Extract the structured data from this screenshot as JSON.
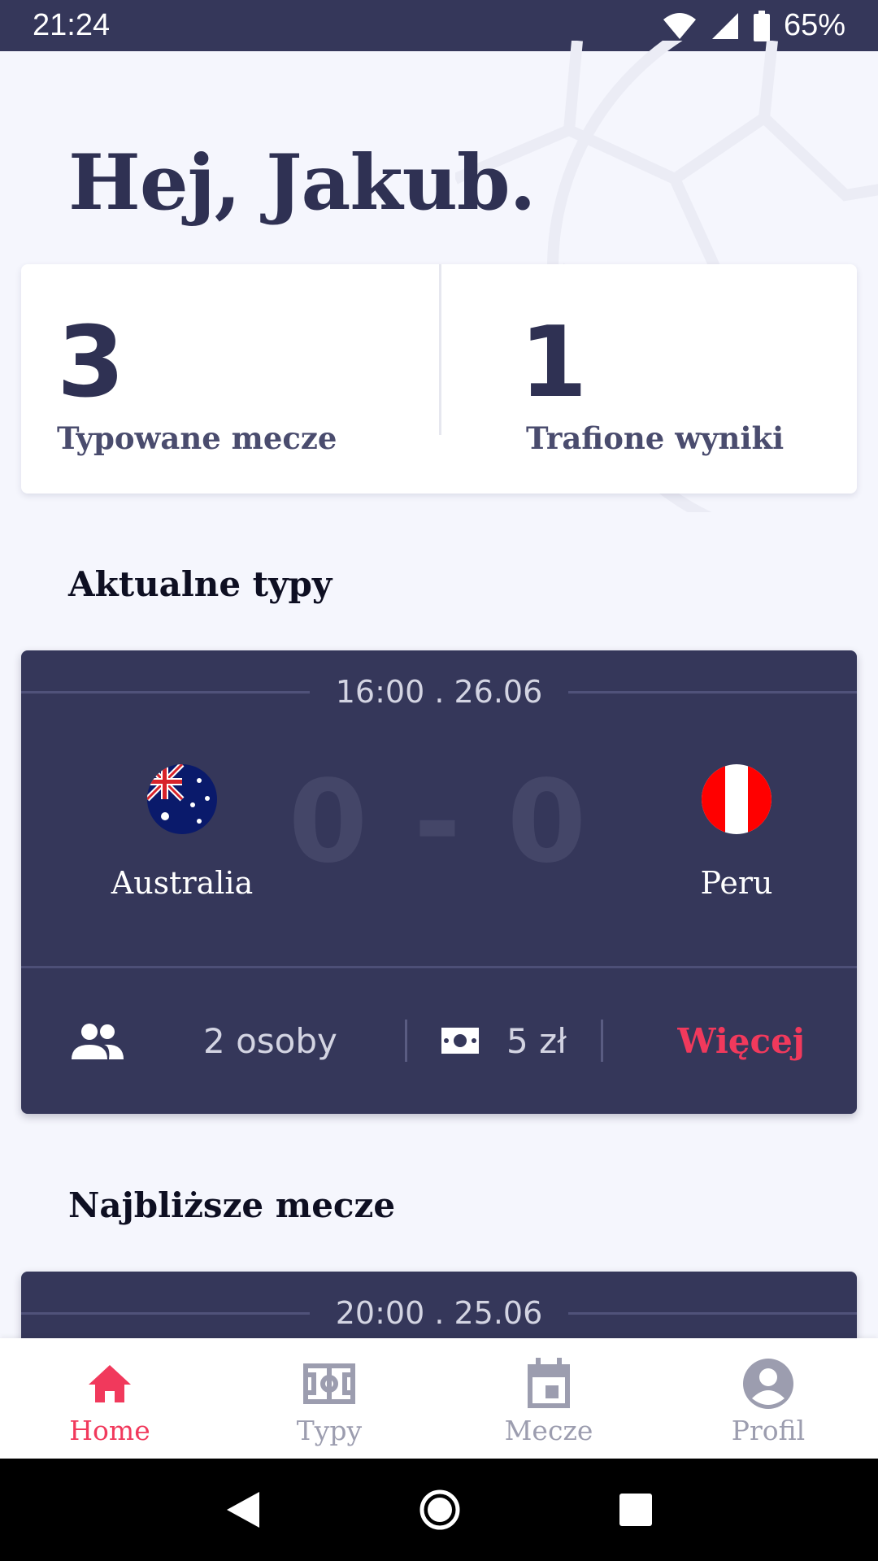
{
  "status_bar": {
    "time": "21:24",
    "battery": "65%"
  },
  "greeting": "Hej, Jakub.",
  "stats": [
    {
      "value": "3",
      "label": "Typowane mecze"
    },
    {
      "value": "1",
      "label": "Trafione wyniki"
    }
  ],
  "current_tips": {
    "title": "Aktualne typy",
    "match": {
      "time": "16:00 . 26.06",
      "home_team": "Australia",
      "away_team": "Peru",
      "score": "0 - 0",
      "people": "2 osoby",
      "stake": "5 zł",
      "more_label": "Więcej"
    }
  },
  "upcoming": {
    "title": "Najbliższe mecze",
    "match": {
      "time": "20:00 . 25.06"
    }
  },
  "bottom_nav": [
    {
      "label": "Home",
      "icon": "home-icon",
      "active": true
    },
    {
      "label": "Typy",
      "icon": "pitch-icon",
      "active": false
    },
    {
      "label": "Mecze",
      "icon": "calendar-icon",
      "active": false
    },
    {
      "label": "Profil",
      "icon": "account-icon",
      "active": false
    }
  ],
  "colors": {
    "primary": "#35375a",
    "accent": "#f1395c",
    "background": "#f5f6fd"
  }
}
